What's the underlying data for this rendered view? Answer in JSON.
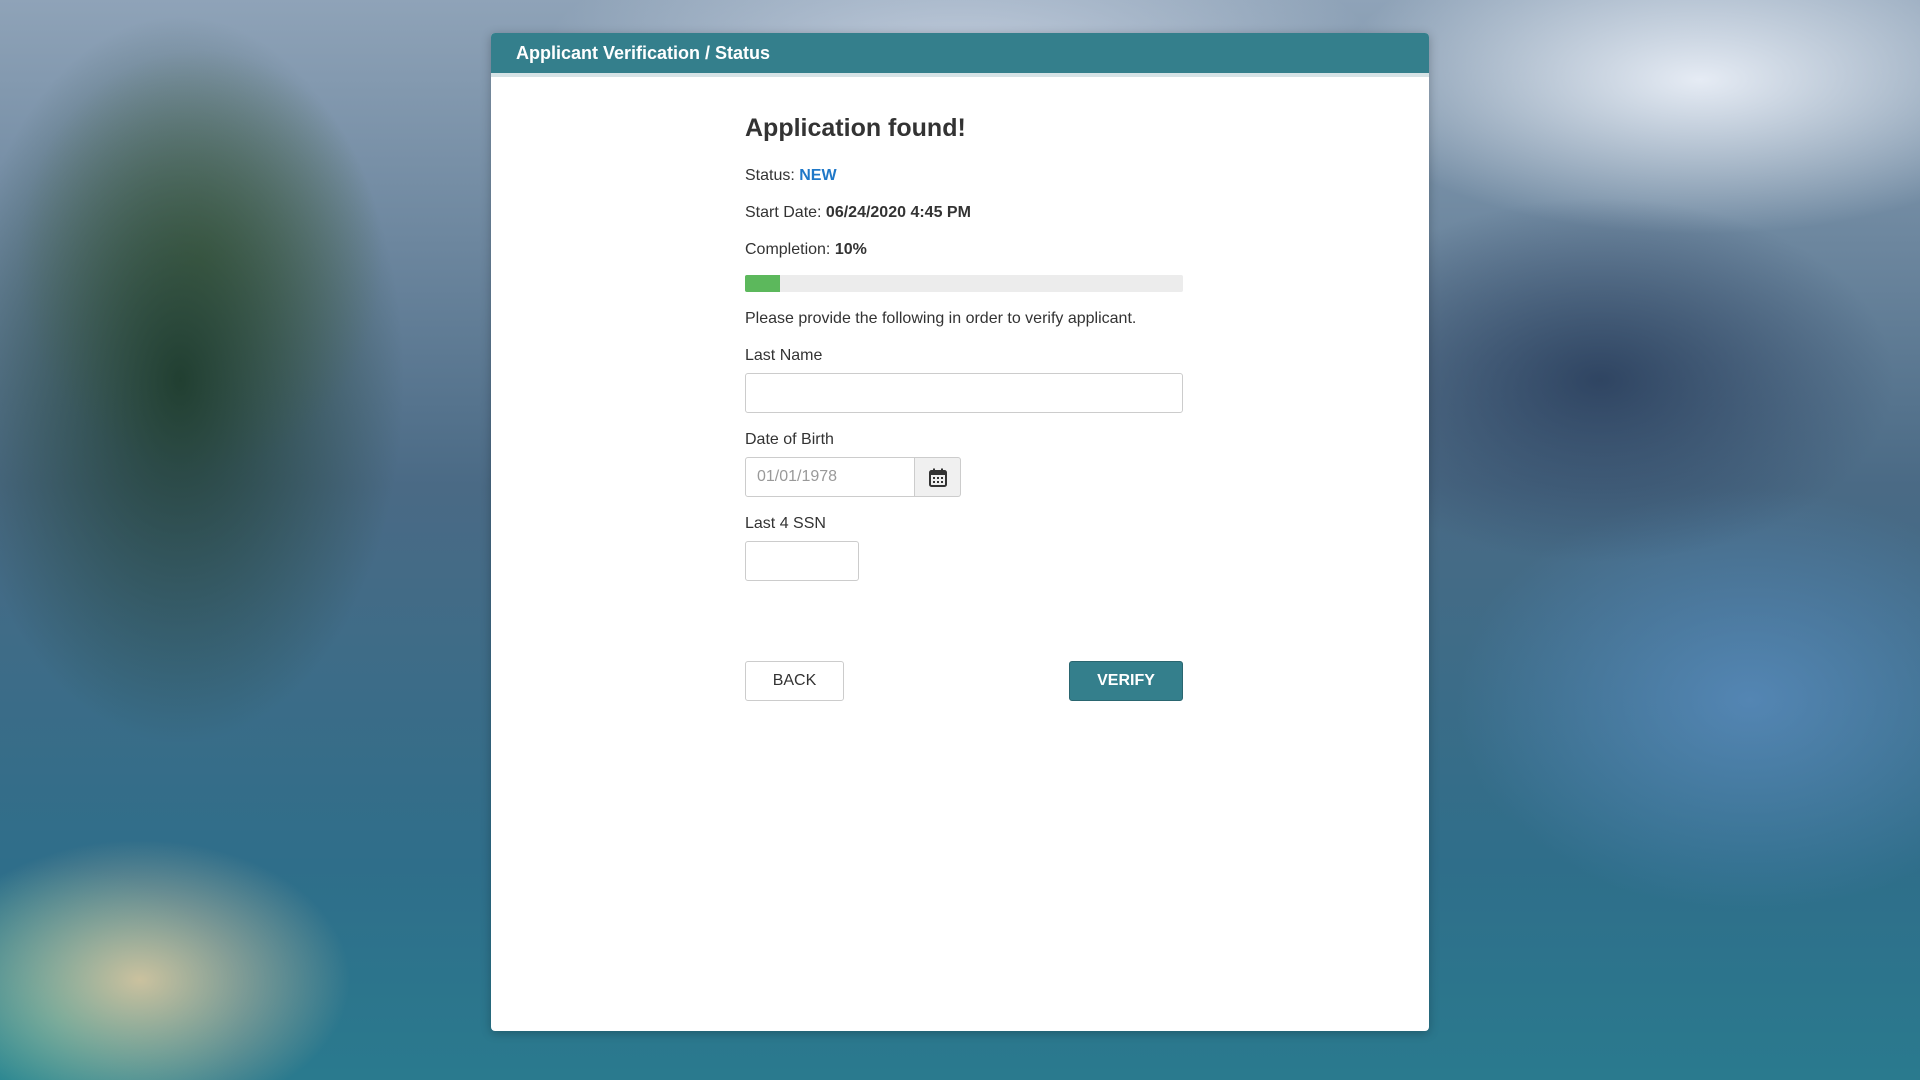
{
  "header": {
    "title": "Applicant Verification / Status"
  },
  "main": {
    "heading": "Application found!",
    "status_label": "Status: ",
    "status_value": "NEW",
    "start_date_label": "Start Date: ",
    "start_date_value": "06/24/2020 4:45 PM",
    "completion_label": "Completion: ",
    "completion_value": "10%",
    "completion_fraction": 0.08,
    "instructions": "Please provide the following in order to verify applicant."
  },
  "form": {
    "last_name": {
      "label": "Last Name",
      "value": "",
      "placeholder": ""
    },
    "dob": {
      "label": "Date of Birth",
      "value": "",
      "placeholder": "01/01/1978",
      "icon": "calendar-icon"
    },
    "ssn": {
      "label": "Last 4 SSN",
      "value": "",
      "placeholder": ""
    }
  },
  "actions": {
    "back_label": "BACK",
    "verify_label": "VERIFY"
  },
  "colors": {
    "header_bg": "#347f8c",
    "status_value": "#1f78c8",
    "progress_fill": "#5cb85c",
    "verify_bg": "#347f8c"
  }
}
